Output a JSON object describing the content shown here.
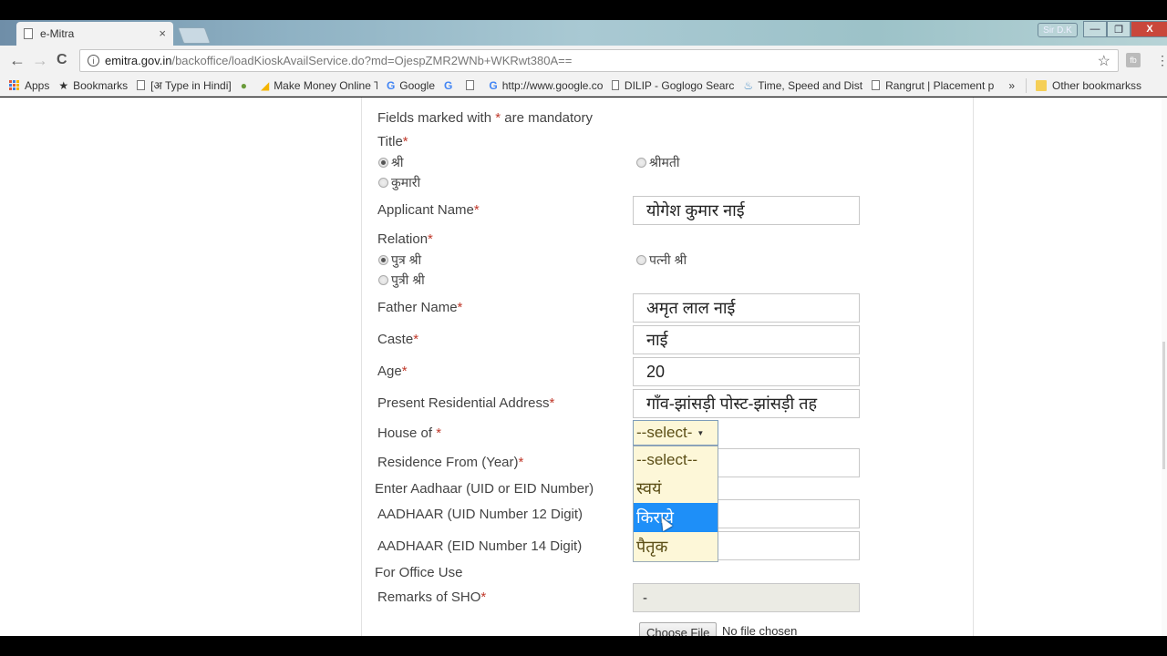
{
  "browser": {
    "tab": {
      "title": "e-Mitra",
      "close": "×"
    },
    "window_user": "Sir D.K",
    "window_controls": {
      "minimize": "—",
      "maximize": "❐",
      "close": "X"
    },
    "url": {
      "domain": "emitra.gov.in",
      "path": "/backoffice/loadKioskAvailService.do?md=OjespZMR2WNb+WKRwt380A=="
    },
    "nav": {
      "back": "←",
      "forward": "→",
      "reload": "C"
    },
    "ext_icon": "fb",
    "bookmarks": [
      {
        "label": "Apps",
        "icon": "apps-grid-icon"
      },
      {
        "label": "Bookmarks",
        "icon": "star-icon"
      },
      {
        "label": "[अ Type in Hindi]",
        "icon": "page-icon"
      },
      {
        "label": "",
        "icon": "ext-icon"
      },
      {
        "label": "Make Money Online T",
        "icon": "adwords-icon"
      },
      {
        "label": "Google",
        "icon": "google-icon"
      },
      {
        "label": "",
        "icon": "google-icon"
      },
      {
        "label": "",
        "icon": "page-icon"
      },
      {
        "label": "http://www.google.co",
        "icon": "google-icon"
      },
      {
        "label": "DILIP - Goglogo Searc",
        "icon": "page-icon"
      },
      {
        "label": "Time, Speed and Dist",
        "icon": "lamp-icon"
      },
      {
        "label": "Rangrut | Placement p",
        "icon": "page-icon"
      }
    ],
    "overflow": "»",
    "other_bookmarks": "Other bookmarkss"
  },
  "form": {
    "mandatory_note_pre": "Fields marked with ",
    "mandatory_note_star": "*",
    "mandatory_note_post": " are mandatory",
    "required_mark": "*",
    "title": {
      "label": "Title",
      "options": [
        {
          "label": "श्री",
          "checked": true
        },
        {
          "label": "श्रीमती",
          "checked": false
        },
        {
          "label": "कुमारी",
          "checked": false
        }
      ]
    },
    "applicant_name": {
      "label": "Applicant Name",
      "value": "योगेश कुमार नाई"
    },
    "relation": {
      "label": "Relation",
      "options": [
        {
          "label": "पुत्र श्री",
          "checked": true
        },
        {
          "label": "पत्नी श्री",
          "checked": false
        },
        {
          "label": "पुत्री श्री",
          "checked": false
        }
      ]
    },
    "father_name": {
      "label": "Father Name",
      "value": "अमृत लाल नाई"
    },
    "caste": {
      "label": "Caste",
      "value": "नाई"
    },
    "age": {
      "label": "Age",
      "value": "20"
    },
    "address": {
      "label": "Present Residential Address",
      "value": "गाँव-झांसड़ी पोस्ट-झांसड़ी तह"
    },
    "house_of": {
      "label": "House of ",
      "selected": "--select-",
      "options": [
        "--select--",
        "स्वयं",
        "किराये",
        "पैतृक"
      ],
      "highlighted_index": 2
    },
    "residence_from": {
      "label": "Residence From (Year)",
      "value": ""
    },
    "aadhaar_heading": "Enter Aadhaar (UID or EID Number)",
    "aadhaar_uid": {
      "label": "AADHAAR (UID Number 12 Digit)",
      "value": ""
    },
    "aadhaar_eid": {
      "label": "AADHAAR (EID Number 14 Digit)",
      "value": ""
    },
    "office_use_heading": "For Office Use",
    "remarks_sho": {
      "label": "Remarks of SHO",
      "value": "-"
    },
    "file": {
      "button": "Choose File",
      "status": "No file chosen"
    }
  },
  "colors": {
    "required": "#c0392b",
    "dropdown_bg": "#fdf7d8",
    "dropdown_highlight": "#1e8ff8"
  }
}
